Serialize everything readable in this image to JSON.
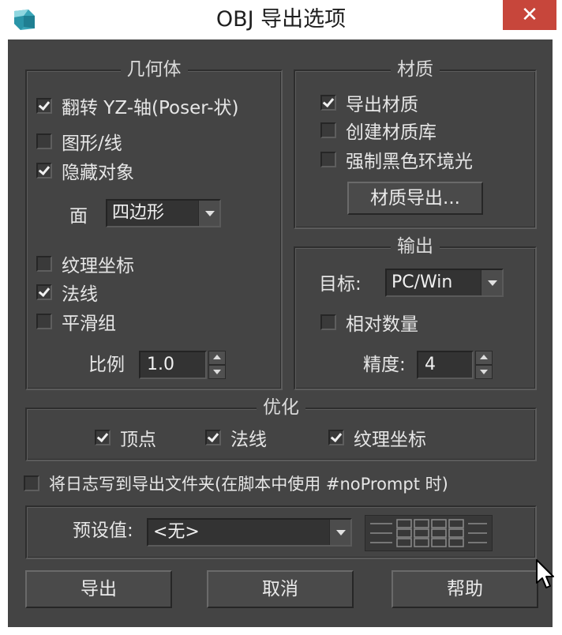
{
  "window": {
    "title": "OBJ 导出选项",
    "close_glyph": "✕"
  },
  "geometry": {
    "title": "几何体",
    "flip_yz": {
      "label": "翻转 YZ-轴(Poser-状)",
      "checked": true
    },
    "shapes_lines": {
      "label": "图形/线",
      "checked": false
    },
    "hidden_objects": {
      "label": "隐藏对象",
      "checked": true
    },
    "faces": {
      "label": "面",
      "value": "四边形"
    },
    "texture_coords": {
      "label": "纹理坐标",
      "checked": false
    },
    "normals": {
      "label": "法线",
      "checked": true
    },
    "smoothing_groups": {
      "label": "平滑组",
      "checked": false
    },
    "scale": {
      "label": "比例",
      "value": "1.0"
    }
  },
  "material": {
    "title": "材质",
    "export_materials": {
      "label": "导出材质",
      "checked": true
    },
    "create_mat_lib": {
      "label": "创建材质库",
      "checked": false
    },
    "force_black_ambient": {
      "label": "强制黑色环境光",
      "checked": false
    },
    "material_export_button": "材质导出..."
  },
  "output": {
    "title": "输出",
    "target": {
      "label": "目标:",
      "value": "PC/Win"
    },
    "relative_numbers": {
      "label": "相对数量",
      "checked": false
    },
    "precision": {
      "label": "精度:",
      "value": "4"
    }
  },
  "optimize": {
    "title": "优化",
    "vertices": {
      "label": "顶点",
      "checked": true
    },
    "normals": {
      "label": "法线",
      "checked": true
    },
    "texture_coords": {
      "label": "纹理坐标",
      "checked": true
    }
  },
  "log": {
    "label": "将日志写到导出文件夹(在脚本中使用 #noPrompt 时)",
    "checked": false
  },
  "presets": {
    "label": "预设值:",
    "value": "<无>"
  },
  "buttons": {
    "export": "导出",
    "cancel": "取消",
    "help": "帮助"
  },
  "colors": {
    "background": "#444444",
    "close_button": "#c7463b",
    "text": "#e6e6e6"
  }
}
